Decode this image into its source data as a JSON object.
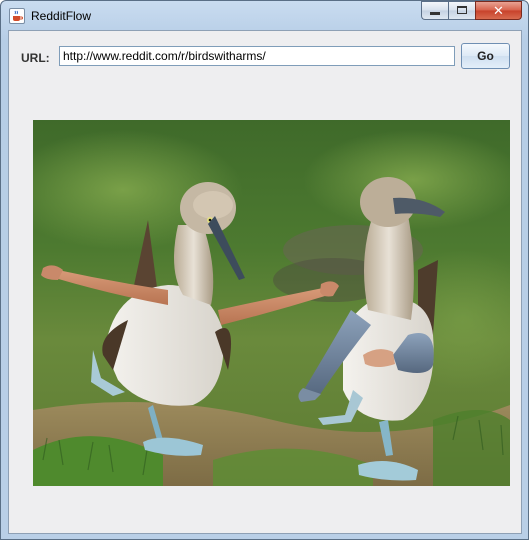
{
  "window": {
    "title": "RedditFlow",
    "app_icon": "java-cup-icon",
    "controls": [
      "minimize-icon",
      "maximize-icon",
      "close-icon"
    ]
  },
  "toolbar": {
    "url_label": "URL:",
    "url_value": "http://www.reddit.com/r/birdswitharms/",
    "go_label": "Go"
  },
  "image": {
    "subject": "two blue-footed boobies with human arms dancing on grass"
  },
  "colors": {
    "client_bg": "#eeeef0",
    "titlebar": "#b9cfe7",
    "close_button": "#c7412a"
  }
}
